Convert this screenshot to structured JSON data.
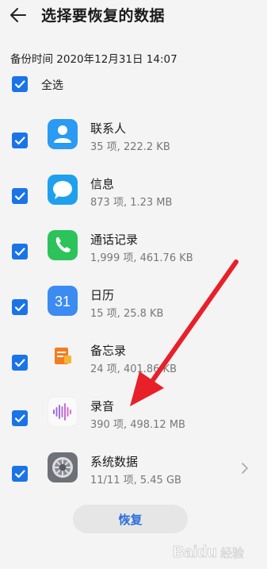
{
  "header": {
    "title": "选择要恢复的数据",
    "back_icon": "arrow-left-icon"
  },
  "backup_time": "备份时间 2020年12月31日 14:07",
  "select_all": {
    "label": "全选",
    "checked": true
  },
  "items": [
    {
      "name": "联系人",
      "meta": "35 项, 222.2 KB",
      "icon": "contacts-icon",
      "checked": true
    },
    {
      "name": "信息",
      "meta": "873 项, 1.23 MB",
      "icon": "messages-icon",
      "checked": true
    },
    {
      "name": "通话记录",
      "meta": "1,999 项, 461.76 KB",
      "icon": "phone-icon",
      "checked": true
    },
    {
      "name": "日历",
      "meta": "15 项, 25.8 KB",
      "icon": "calendar-icon",
      "checked": true,
      "icon_text": "31"
    },
    {
      "name": "备忘录",
      "meta": "24 项, 401.86 KB",
      "icon": "notes-icon",
      "checked": true
    },
    {
      "name": "录音",
      "meta": "390 项, 498.12 MB",
      "icon": "recorder-icon",
      "checked": true
    },
    {
      "name": "系统数据",
      "meta": "11/11 项, 5.45 GB",
      "icon": "settings-gear-icon",
      "checked": true
    }
  ],
  "restore_button": "恢复",
  "colors": {
    "accent": "#1a74e8",
    "arrow": "#e8202a",
    "button_text": "#2a6fd8"
  },
  "watermark": "Baidu 经验"
}
